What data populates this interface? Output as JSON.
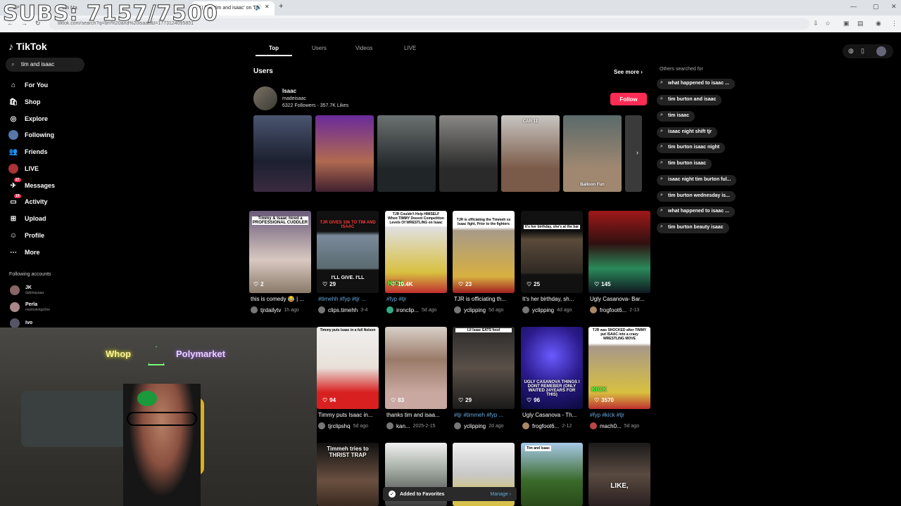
{
  "overlay": {
    "subs": "SUBS: 7157/7500"
  },
  "browser": {
    "tabs": [
      "CP",
      "9% Ma",
      "(1) find 'tim and isaac' on Tik"
    ],
    "new_tab": "+",
    "url": "tiktok.com/search?q=tim%20and%20isaac&t=1773124095851"
  },
  "sidebar": {
    "logo": "TikTok",
    "search_value": "tim and isaac",
    "items": [
      {
        "label": "For You",
        "icon": "home-icon"
      },
      {
        "label": "Shop",
        "icon": "shop-icon"
      },
      {
        "label": "Explore",
        "icon": "compass-icon"
      },
      {
        "label": "Following",
        "icon": "following-icon"
      },
      {
        "label": "Friends",
        "icon": "friends-icon"
      },
      {
        "label": "LIVE",
        "icon": "live-icon"
      },
      {
        "label": "Messages",
        "icon": "messages-icon",
        "badge": "27"
      },
      {
        "label": "Activity",
        "icon": "activity-icon",
        "badge": "19"
      },
      {
        "label": "Upload",
        "icon": "upload-icon"
      },
      {
        "label": "Profile",
        "icon": "profile-icon"
      },
      {
        "label": "More",
        "icon": "more-icon"
      }
    ],
    "following_heading": "Following accounts",
    "following": [
      {
        "name": "JK",
        "handle": "dubmayaaa"
      },
      {
        "name": "Perla",
        "handle": "nosmokingz0ne"
      },
      {
        "name": "Ivo",
        "handle": ""
      }
    ]
  },
  "tabs": [
    "Top",
    "Users",
    "Videos",
    "LIVE"
  ],
  "users_section": {
    "heading": "Users",
    "see_more": "See more",
    "name": "Isaac",
    "handle": "madeisaac",
    "stats": "6322 Followers · 357.7K Likes",
    "follow": "Follow",
    "thumb_captions": [
      "",
      "",
      "",
      "",
      "CAR 11",
      "",
      "Balloon Fun"
    ]
  },
  "videos": [
    {
      "caption": "Timmy & Isaac hired a PROFESSIONAL CUDDLER",
      "count": "2",
      "desc": "this is comedy 😂 | ...",
      "tags": "",
      "author": "tjrdailytv",
      "date": "1h ago"
    },
    {
      "caption": "TJR GIVES 10k TO TIM AND ISAAC",
      "count": "29",
      "desc": "",
      "tags": "#timehh #fyp #tjr ...",
      "author": "clips.timehh",
      "date": "3-4",
      "overlay": "I'LL GIVE. I'LL"
    },
    {
      "caption": "TJR Couldn't Help HIMSELF When TIMMY Doesnt Competition Levels Of WRESTLING on Isaac",
      "count": "10.4K",
      "desc": "",
      "tags": "#fyp #tjr",
      "author": "ironclip...",
      "date": "5d ago",
      "overlay": "KICK"
    },
    {
      "caption": "TJR is officiating the Timmeh vs Isaac fight, Prior to the fighters",
      "count": "23",
      "desc": "TJR is officiating th...",
      "tags": "",
      "author": "yclipping",
      "date": "5d ago"
    },
    {
      "caption": "It's her birthday, she's at the bar",
      "count": "25",
      "desc": "It's her birthday, sh...",
      "tags": "",
      "author": "yclipping",
      "date": "4d ago"
    },
    {
      "caption": "",
      "count": "145",
      "desc": "Ugly Casanova- Bar...",
      "tags": "",
      "author": "frogfoot6...",
      "date": "2-13"
    },
    {
      "caption": "Timmy puts Isaac in a full Nelson",
      "count": "94",
      "desc": "Timmy puts Isaac in...",
      "tags": "",
      "author": "tjrclipshq",
      "date": "5d ago"
    },
    {
      "caption": "",
      "count": "83",
      "desc": "thanks tim and isaa...",
      "tags": "",
      "author": "kan...",
      "date": "2025-2-15"
    },
    {
      "caption": "Lil Isaac EATS food",
      "count": "29",
      "desc": "",
      "tags": "#tjr #timmeh #fyp ...",
      "author": "yclipping",
      "date": "2d ago"
    },
    {
      "caption": "UGLY CASANOVA THINGS I DONT REMEBER (ONLY WAITED 24YEARS FOR THIS)",
      "count": "96",
      "desc": "Ugly Casanova - Th...",
      "tags": "",
      "author": "frogfoot6...",
      "date": "2-12"
    },
    {
      "caption": "TJR was SHOCKED after TIMMY put ISAAC into a crazy WRESTLING MOVE",
      "count": "3570",
      "desc": "",
      "tags": "#fyp #kick #tjr",
      "author": "mach0...",
      "date": "5d ago",
      "overlay": "KICK"
    },
    {
      "caption": "Timmeh tries to THRIST TRAP",
      "count": "",
      "desc": "",
      "tags": "",
      "author": "",
      "date": ""
    },
    {
      "caption": "",
      "count": "",
      "desc": "",
      "tags": "",
      "author": "",
      "date": ""
    },
    {
      "caption": "",
      "count": "",
      "desc": "",
      "tags": "",
      "author": "",
      "date": ""
    },
    {
      "caption": "Tim and Isaac",
      "count": "",
      "desc": "",
      "tags": "",
      "author": "",
      "date": ""
    },
    {
      "caption": "",
      "count": "",
      "desc": "",
      "tags": "",
      "author": "",
      "date": "",
      "overlay": "LIKE,"
    }
  ],
  "others": {
    "heading": "Others searched for",
    "items": [
      "what happened to isaac ...",
      "tim burton and isaac",
      "tim isaac",
      "isaac night shift tjr",
      "tim burton isaac night",
      "tim burton isaac",
      "isaac night tim burton ful...",
      "tim burton wednesday is...",
      "what happened to isaac ...",
      "tim burton beauty isaac"
    ]
  },
  "toast": {
    "text": "Added to Favorites",
    "action": "Manage"
  },
  "webcam": {
    "sign1": "Whop",
    "sign2": "Polymarket"
  },
  "colors": {
    "accent": "#fe2c55",
    "bg": "#000000",
    "pill": "#222222"
  }
}
